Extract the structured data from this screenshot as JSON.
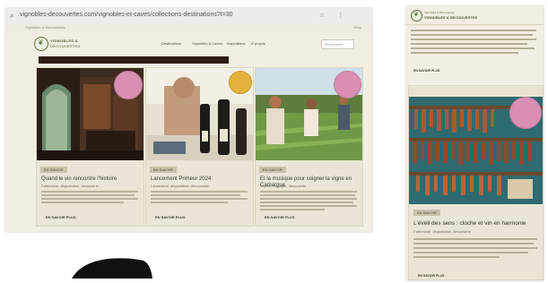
{
  "desktop": {
    "url": "vignobles-decouvertes.com/vignobles-et-caves/collections-destinations?t=30",
    "topstrip_text": "Vignobles & Découvertes",
    "topstrip_shop": "Shop",
    "logo_title": "VIGNOBLES &",
    "logo_sub": "DÉCOUVERTES",
    "nav": [
      "Destinations",
      "Vignobles & Caves",
      "Inspirations",
      "À propos"
    ],
    "search_placeholder": "Rechercher",
    "cards": [
      {
        "badge": "EN SAVOIR",
        "title": "Quand le vin rencontre l'histoire",
        "meta": "Patrimoine, dégustation, découverte",
        "cta": "EN SAVOIR PLUS"
      },
      {
        "badge": "EN SAVOIR",
        "title": "Lancement Primeur 2024",
        "meta": "Lancement, dégustation, découverte",
        "cta": "EN SAVOIR PLUS"
      },
      {
        "badge": "EN SAVOIR",
        "title": "Et la musique pour soigner la vigne en Camargue",
        "meta": "Vignes, musique, découverte",
        "cta": "EN SAVOIR PLUS"
      }
    ]
  },
  "mobile": {
    "brand_top": "Vignobles & Découvertes",
    "brand": "VIGNOBLES & DÉCOUVERTES",
    "cta1": "EN SAVOIR PLUS",
    "badge": "EN SAVOIR",
    "title": "L'éveil des sens : cloche et vin en harmonie",
    "meta": "Patrimoine, dégustation, découverte",
    "cta2": "EN SAVOIR PLUS"
  },
  "colors": {
    "page_bg": "#f2eee2",
    "card_bg": "#eae5d6",
    "brand_green": "#566b3a",
    "medal_pink": "#d88fb2",
    "medal_gold": "#e3b23c"
  }
}
